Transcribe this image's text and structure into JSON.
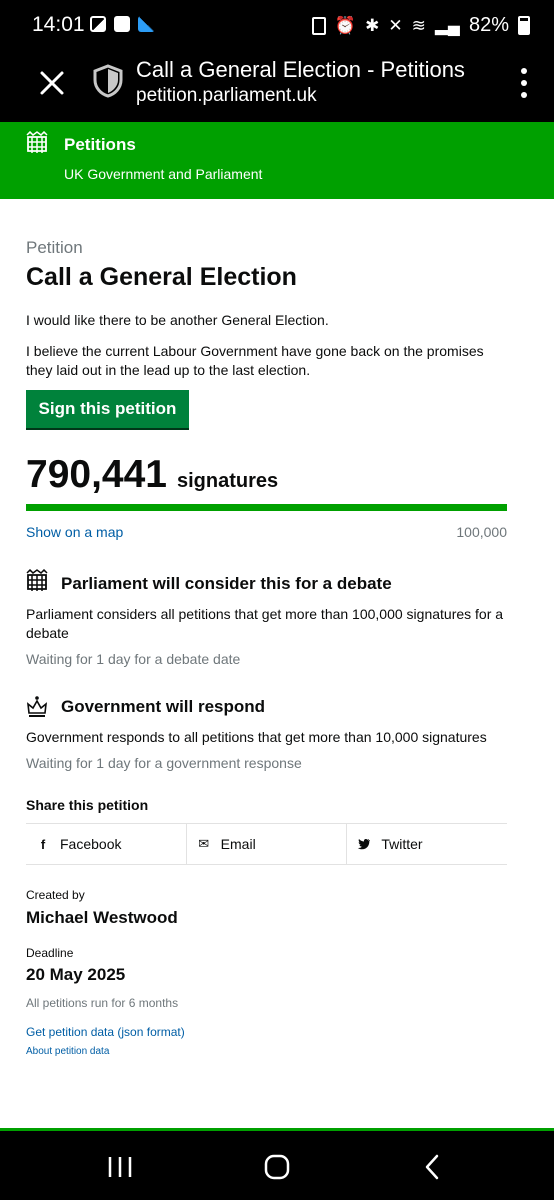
{
  "status_bar": {
    "time": "14:01",
    "battery": "82%"
  },
  "browser": {
    "title": "Call a General Election - Petitions",
    "url": "petition.parliament.uk"
  },
  "site_header": {
    "title": "Petitions",
    "subtitle": "UK Government and Parliament"
  },
  "petition": {
    "caption": "Petition",
    "title": "Call a General Election",
    "paragraphs": [
      "I would like there to be another General Election.",
      "I believe the current Labour Government have gone back on the promises they laid out in the lead up to the last election."
    ],
    "sign_label": "Sign this petition",
    "signature_count": "790,441",
    "signature_label": "signatures",
    "progress_fraction": 1.0,
    "map_link": "Show on a map",
    "threshold": "100,000"
  },
  "debate": {
    "title": "Parliament will consider this for a debate",
    "text": "Parliament considers all petitions that get more than 100,000 signatures for a debate",
    "waiting": "Waiting for 1 day for a debate date"
  },
  "response": {
    "title": "Government will respond",
    "text": "Government responds to all petitions that get more than 10,000 signatures",
    "waiting": "Waiting for 1 day for a government response"
  },
  "share": {
    "title": "Share this petition",
    "items": [
      {
        "label": "Facebook",
        "icon": "facebook-icon",
        "glyph": "f"
      },
      {
        "label": "Email",
        "icon": "email-icon",
        "glyph": "✉"
      },
      {
        "label": "Twitter",
        "icon": "twitter-icon",
        "glyph": "🐦"
      }
    ]
  },
  "meta": {
    "created_label": "Created by",
    "creator": "Michael Westwood",
    "deadline_label": "Deadline",
    "deadline": "20 May 2025",
    "run_note": "All petitions run for 6 months",
    "json_link": "Get petition data (json format)",
    "about_link": "About petition data"
  },
  "colors": {
    "brand_green": "#00a000",
    "button_green": "#00823b",
    "link_blue": "#005ea5",
    "muted_grey": "#6f777b"
  }
}
